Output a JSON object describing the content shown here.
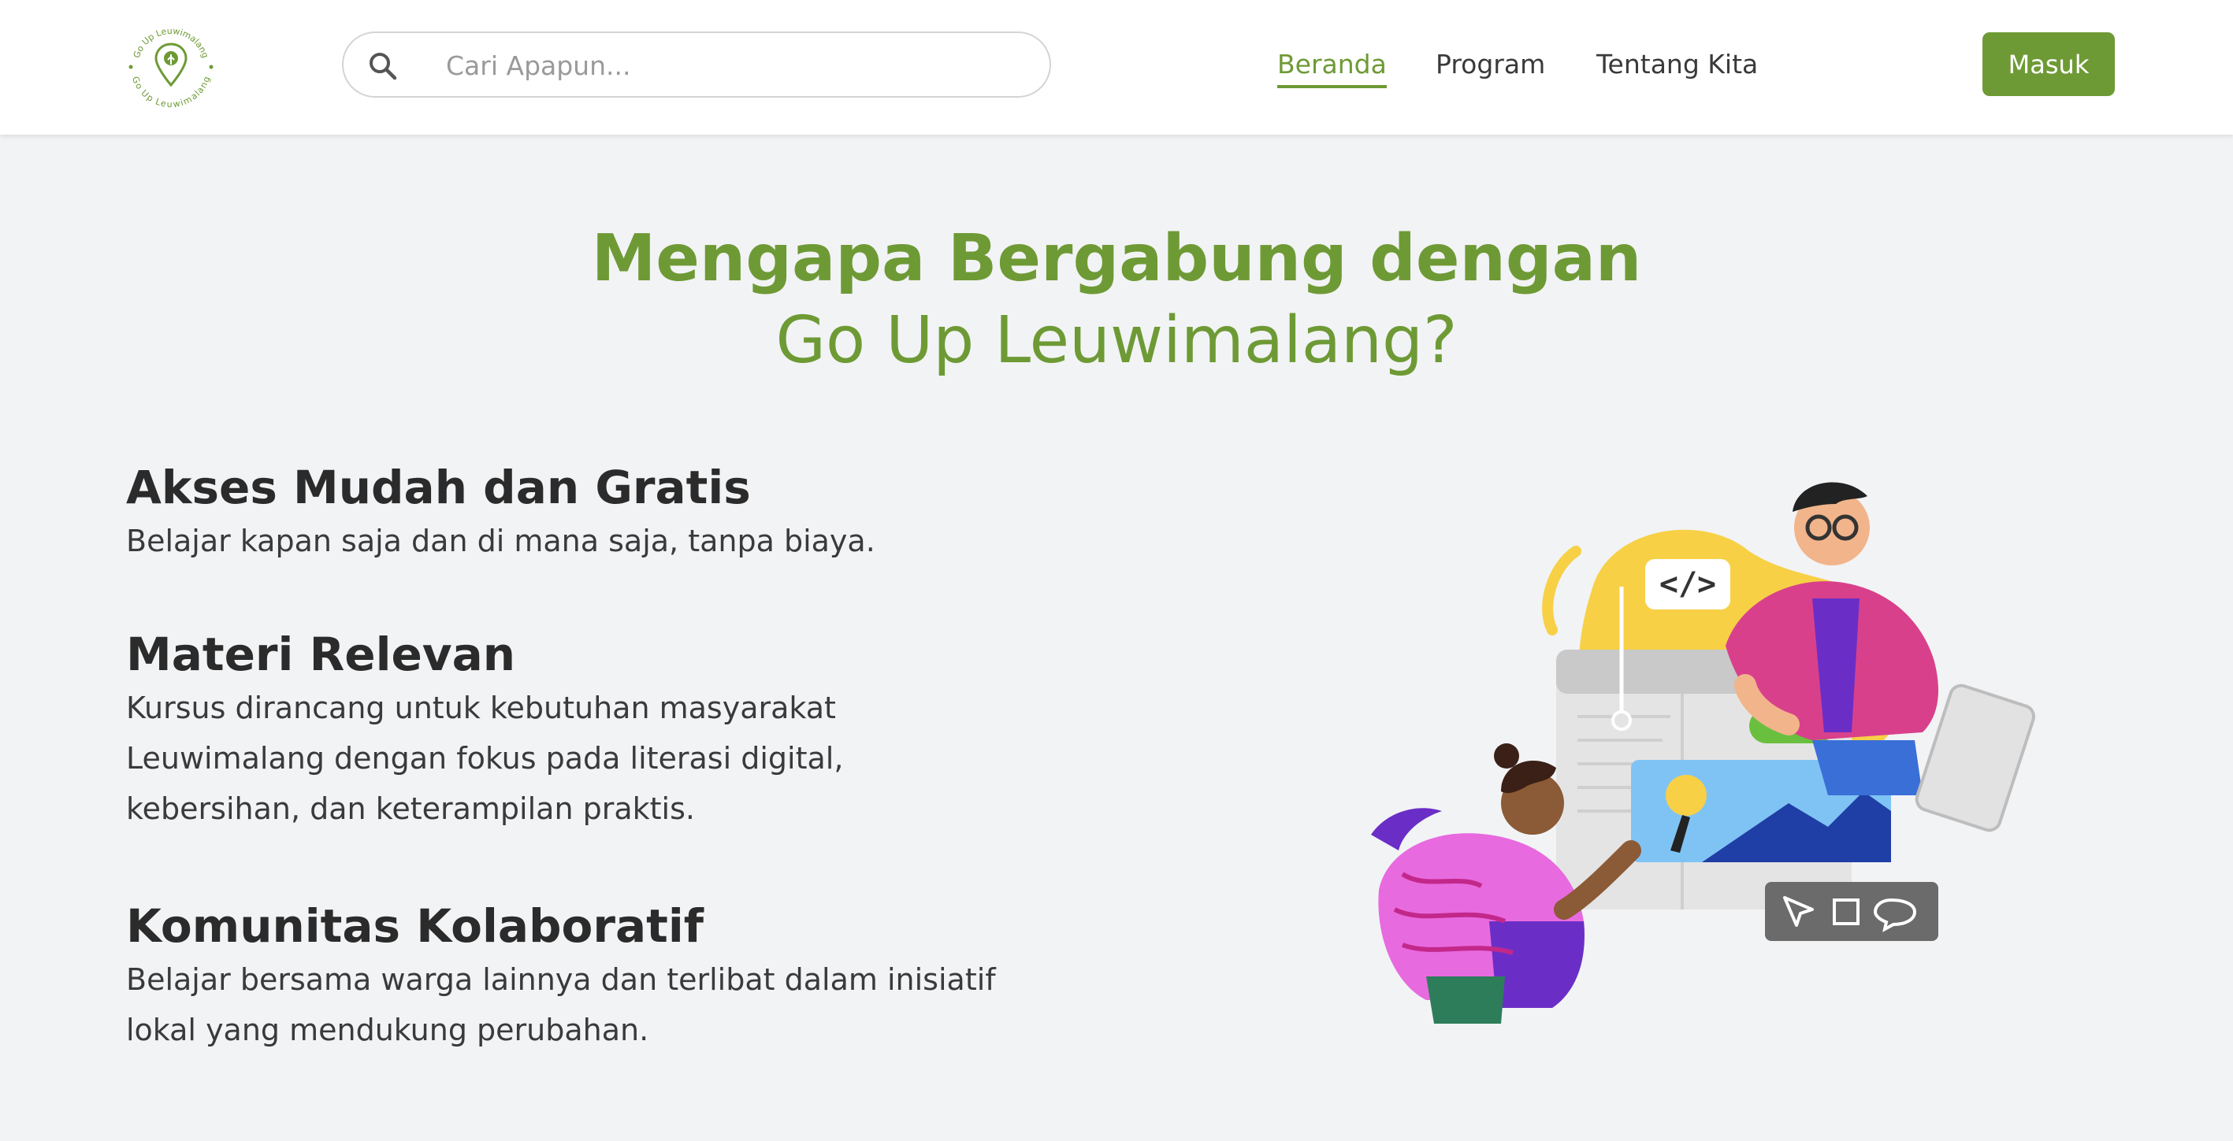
{
  "brand": {
    "logo_text": "Go Up Leuwimalang"
  },
  "search": {
    "placeholder": "Cari Apapun..."
  },
  "nav": [
    {
      "label": "Beranda",
      "active": true
    },
    {
      "label": "Program",
      "active": false
    },
    {
      "label": "Tentang Kita",
      "active": false
    }
  ],
  "login": {
    "label": "Masuk"
  },
  "hero": {
    "title_line1": "Mengapa Bergabung dengan",
    "title_line2": "Go Up Leuwimalang?"
  },
  "features": [
    {
      "title": "Akses Mudah dan Gratis",
      "lines": [
        "Belajar kapan saja dan di mana saja, tanpa biaya."
      ]
    },
    {
      "title": "Materi Relevan",
      "lines": [
        "Kursus dirancang untuk kebutuhan masyarakat",
        "Leuwimalang dengan fokus pada literasi digital,",
        "kebersihan, dan keterampilan praktis."
      ]
    },
    {
      "title": "Komunitas Kolaboratif",
      "lines": [
        "Belajar bersama warga lainnya dan terlibat dalam inisiatif",
        "lokal yang mendukung perubahan."
      ]
    }
  ],
  "illustration": {
    "code_tag": "</>"
  },
  "colors": {
    "brand_green": "#6e9a35",
    "text_dark": "#2b2b2b",
    "page_bg": "#f2f3f5"
  }
}
